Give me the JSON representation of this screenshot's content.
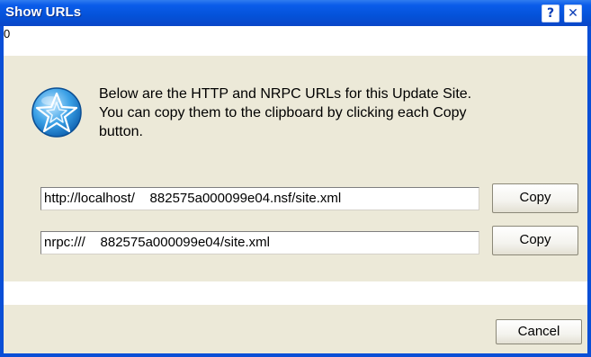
{
  "window": {
    "title": "Show URLs",
    "help_glyph": "?",
    "close_glyph": "✕"
  },
  "top_strip": {
    "value": "0"
  },
  "message": {
    "line1": "Below are the HTTP and NRPC URLs for this Update Site.",
    "line2": "You can copy them to the clipboard by clicking each Copy",
    "line3": "button.",
    "icon": "lotus-notes-star-icon"
  },
  "urls": {
    "http": "http://localhost/    882575a000099e04.nsf/site.xml",
    "nrpc": "nrpc:///    882575a000099e04/site.xml"
  },
  "buttons": {
    "copy_http": "Copy",
    "copy_nrpc": "Copy",
    "cancel": "Cancel"
  },
  "colors": {
    "titlebar": "#0452d9",
    "dialog_bg": "#ece9d8",
    "icon_blue": "#2a8fd8"
  }
}
